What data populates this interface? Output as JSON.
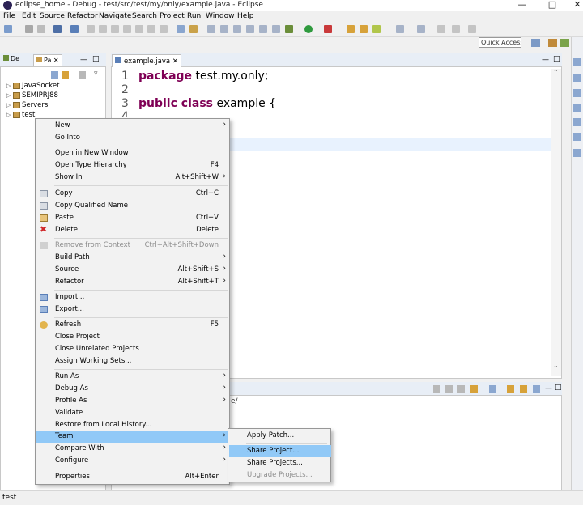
{
  "window": {
    "title": "eclipse_home - Debug - test/src/test/my/only/example.java - Eclipse"
  },
  "menubar": [
    "File",
    "Edit",
    "Source",
    "Refactor",
    "Navigate",
    "Search",
    "Project",
    "Run",
    "Window",
    "Help"
  ],
  "toolbar": {
    "quick_access": "Quick Access"
  },
  "left_panel": {
    "tabs": [
      {
        "label": "De"
      },
      {
        "label": "Pa"
      }
    ],
    "tree": [
      {
        "label": "JavaSocket"
      },
      {
        "label": "SEMIPRJ88"
      },
      {
        "label": "Servers"
      },
      {
        "label": "test"
      }
    ]
  },
  "editor": {
    "tab": "example.java",
    "lines": [
      {
        "n": "1",
        "kw": "package",
        "rest": " test.my.only;"
      },
      {
        "n": "2",
        "kw": "",
        "rest": ""
      },
      {
        "n": "3",
        "kw": "public class",
        "rest": " example {"
      },
      {
        "n": "4",
        "kw": "",
        "rest": ""
      }
    ]
  },
  "console": {
    "partial_text": "e/"
  },
  "status": {
    "text": "test"
  },
  "context_menu": {
    "items": [
      {
        "label": "New",
        "accel": "",
        "submenu": true,
        "disabled": false
      },
      {
        "label": "Go Into",
        "accel": "",
        "submenu": false,
        "disabled": false
      },
      {
        "label": "Open in New Window",
        "accel": "",
        "submenu": false,
        "disabled": false
      },
      {
        "label": "Open Type Hierarchy",
        "accel": "F4",
        "submenu": false,
        "disabled": false
      },
      {
        "label": "Show In",
        "accel": "Alt+Shift+W",
        "submenu": true,
        "disabled": false
      },
      {
        "label": "Copy",
        "accel": "Ctrl+C",
        "submenu": false,
        "disabled": false
      },
      {
        "label": "Copy Qualified Name",
        "accel": "",
        "submenu": false,
        "disabled": false
      },
      {
        "label": "Paste",
        "accel": "Ctrl+V",
        "submenu": false,
        "disabled": false
      },
      {
        "label": "Delete",
        "accel": "Delete",
        "submenu": false,
        "disabled": false
      },
      {
        "label": "Remove from Context",
        "accel": "Ctrl+Alt+Shift+Down",
        "submenu": false,
        "disabled": true
      },
      {
        "label": "Build Path",
        "accel": "",
        "submenu": true,
        "disabled": false
      },
      {
        "label": "Source",
        "accel": "Alt+Shift+S",
        "submenu": true,
        "disabled": false
      },
      {
        "label": "Refactor",
        "accel": "Alt+Shift+T",
        "submenu": true,
        "disabled": false
      },
      {
        "label": "Import...",
        "accel": "",
        "submenu": false,
        "disabled": false
      },
      {
        "label": "Export...",
        "accel": "",
        "submenu": false,
        "disabled": false
      },
      {
        "label": "Refresh",
        "accel": "F5",
        "submenu": false,
        "disabled": false
      },
      {
        "label": "Close Project",
        "accel": "",
        "submenu": false,
        "disabled": false
      },
      {
        "label": "Close Unrelated Projects",
        "accel": "",
        "submenu": false,
        "disabled": false
      },
      {
        "label": "Assign Working Sets...",
        "accel": "",
        "submenu": false,
        "disabled": false
      },
      {
        "label": "Run As",
        "accel": "",
        "submenu": true,
        "disabled": false
      },
      {
        "label": "Debug As",
        "accel": "",
        "submenu": true,
        "disabled": false
      },
      {
        "label": "Profile As",
        "accel": "",
        "submenu": true,
        "disabled": false
      },
      {
        "label": "Validate",
        "accel": "",
        "submenu": false,
        "disabled": false
      },
      {
        "label": "Restore from Local History...",
        "accel": "",
        "submenu": false,
        "disabled": false
      },
      {
        "label": "Team",
        "accel": "",
        "submenu": true,
        "disabled": false,
        "highlighted": true
      },
      {
        "label": "Compare With",
        "accel": "",
        "submenu": true,
        "disabled": false
      },
      {
        "label": "Configure",
        "accel": "",
        "submenu": true,
        "disabled": false
      },
      {
        "label": "Properties",
        "accel": "Alt+Enter",
        "submenu": false,
        "disabled": false
      }
    ]
  },
  "team_submenu": {
    "items": [
      {
        "label": "Apply Patch...",
        "disabled": false
      },
      {
        "label": "Share Project...",
        "disabled": false,
        "highlighted": true
      },
      {
        "label": "Share Projects...",
        "disabled": false
      },
      {
        "label": "Upgrade Projects...",
        "disabled": true
      }
    ]
  },
  "colors": {
    "highlight": "#91c9f7",
    "keyword": "#7f0055"
  }
}
